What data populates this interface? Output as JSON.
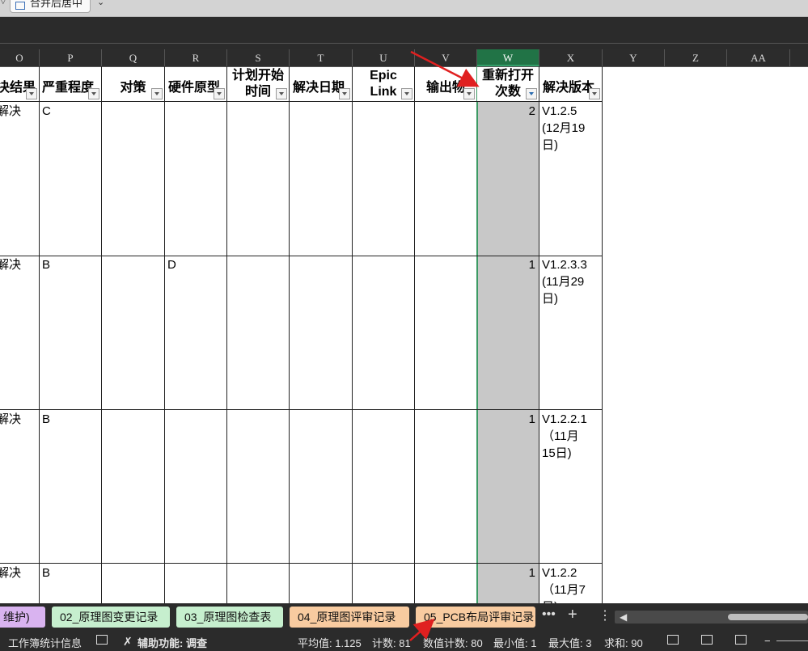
{
  "ribbon": {
    "merge_label": "合并后居中",
    "chevron": "⌄"
  },
  "column_headers": [
    {
      "id": "col-o",
      "label": "O"
    },
    {
      "id": "col-p",
      "label": "P"
    },
    {
      "id": "col-q",
      "label": "Q"
    },
    {
      "id": "col-r",
      "label": "R"
    },
    {
      "id": "col-s",
      "label": "S"
    },
    {
      "id": "col-t",
      "label": "T"
    },
    {
      "id": "col-u",
      "label": "U"
    },
    {
      "id": "col-v",
      "label": "V"
    },
    {
      "id": "col-w",
      "label": "W"
    },
    {
      "id": "col-x",
      "label": "X"
    },
    {
      "id": "col-y",
      "label": "Y"
    },
    {
      "id": "col-z",
      "label": "Z"
    },
    {
      "id": "col-aa",
      "label": "AA"
    }
  ],
  "header_row": {
    "o": "决结果",
    "p": "严重程度",
    "q": "对策",
    "r": "硬件原型",
    "s_line1": "计划开始",
    "s_line2": "时间",
    "t": "解决日期",
    "u_line1": "Epic",
    "u_line2": "Link",
    "v": "输出物",
    "w_line1": "重新打开",
    "w_line2": "次数",
    "x": "解决版本"
  },
  "rows": [
    {
      "o": "解决",
      "p": "C",
      "r": "",
      "w": "2",
      "x": [
        "V1.2.5",
        "(12月19",
        "日)"
      ]
    },
    {
      "o": "解决",
      "p": "B",
      "r": "D",
      "w": "1",
      "x": [
        "V1.2.3.3",
        "(11月29",
        "日)"
      ]
    },
    {
      "o": "解决",
      "p": "B",
      "r": "",
      "w": "1",
      "x": [
        "V1.2.2.1",
        "（11月",
        "15日)"
      ]
    },
    {
      "o": "解决",
      "p": "B",
      "r": "",
      "w": "1",
      "x": [
        "V1.2.2",
        "（11月7",
        "日)"
      ]
    }
  ],
  "sheet_tabs": [
    {
      "label": "维护)",
      "color": "#d9b3f0"
    },
    {
      "label": "02_原理图变更记录",
      "color": "#c6efce"
    },
    {
      "label": "03_原理图检查表",
      "color": "#c6efce"
    },
    {
      "label": "04_原理图评审记录",
      "color": "#f8cba0"
    },
    {
      "label": "05_PCB布局评审记录",
      "color": "#f8cba0"
    }
  ],
  "tab_controls": {
    "more": "•••",
    "add": "+",
    "menu": "⋮",
    "scroll_left": "◀"
  },
  "status": {
    "workbook_stats": "工作簿统计信息",
    "accessibility": "辅助功能: 调查",
    "average": "平均值: 1.125",
    "count": "计数: 81",
    "numeric_count": "数值计数: 80",
    "min": "最小值: 1",
    "max": "最大值: 3",
    "sum": "求和: 90"
  },
  "colors": {
    "selected_column_header": "#217346",
    "selected_column_fill": "#c8c8c8",
    "annotation": "#e02020"
  }
}
